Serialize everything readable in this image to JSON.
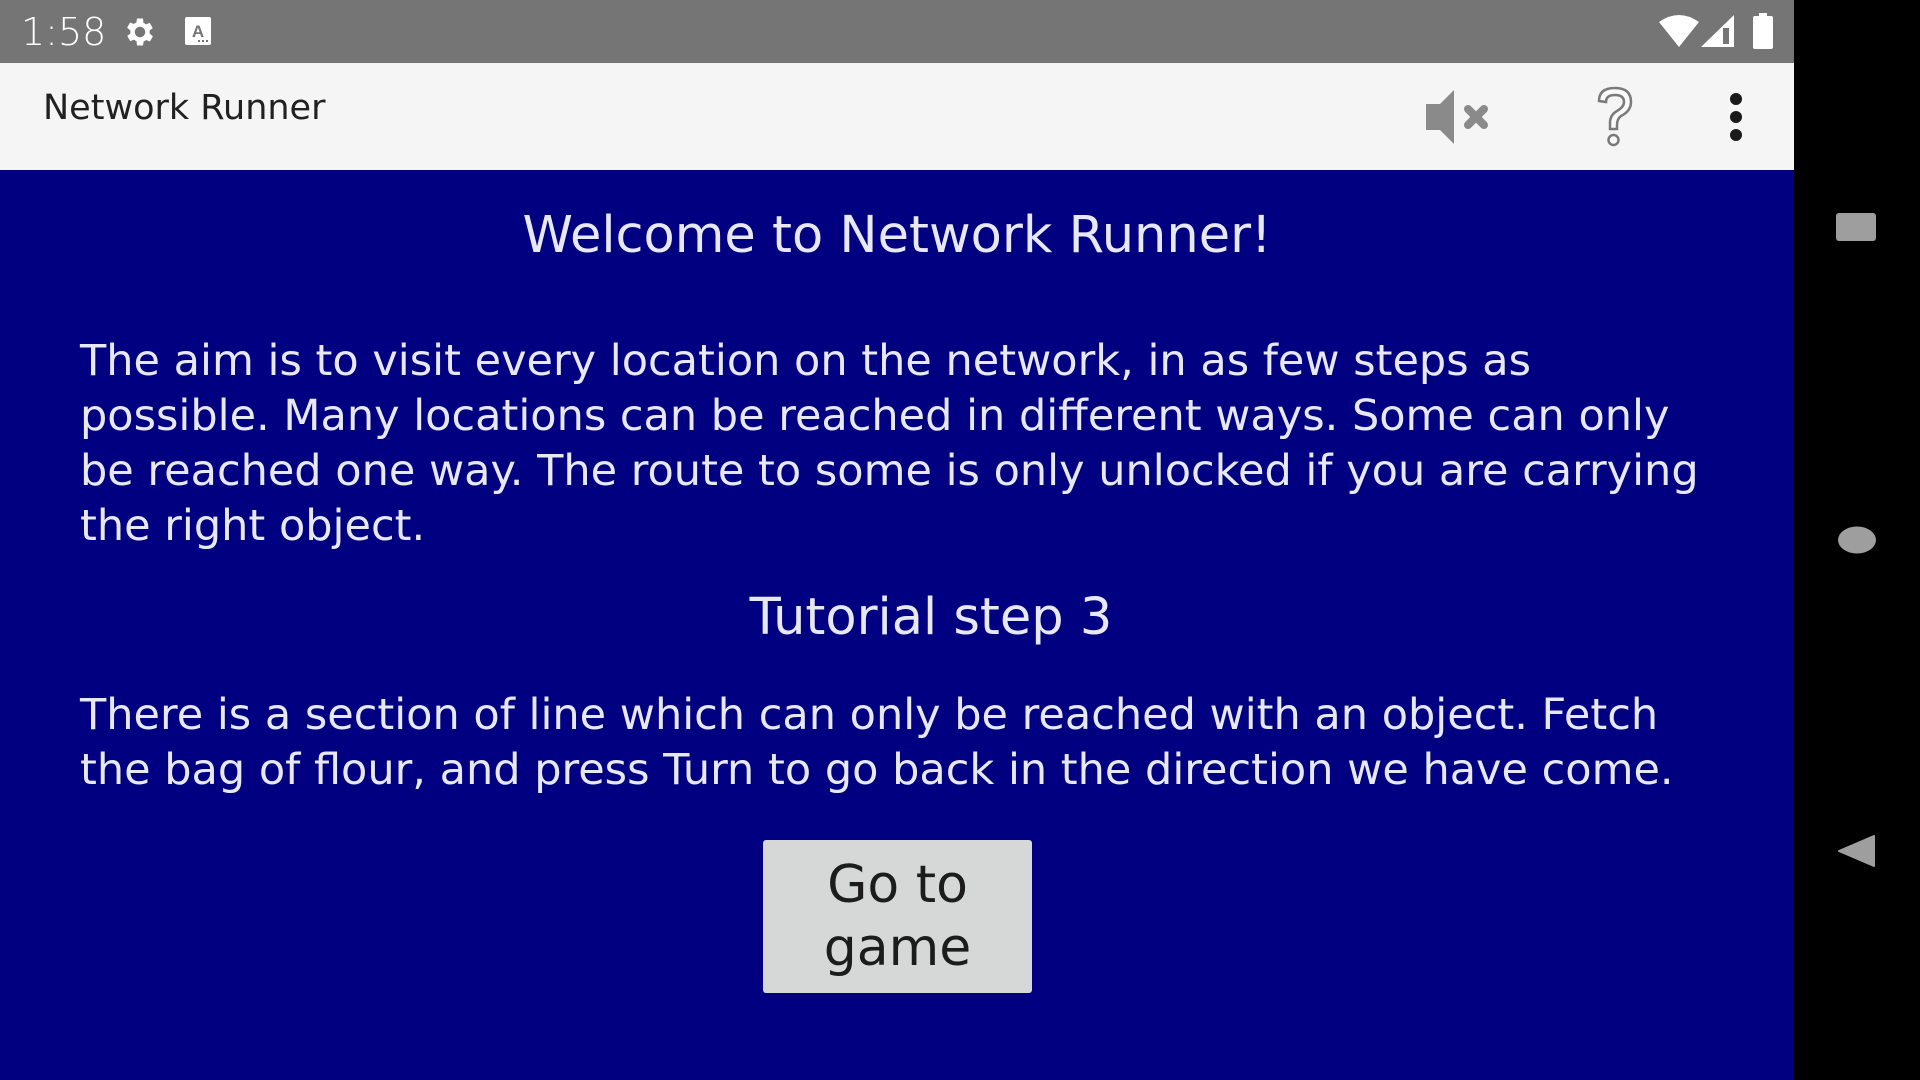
{
  "status_bar": {
    "time": "1:58",
    "icons": [
      "settings-icon",
      "keyboard-a-icon",
      "wifi-icon",
      "cellular-signal-icon",
      "battery-icon"
    ]
  },
  "app_bar": {
    "title": "Network Runner",
    "actions": [
      "mute-icon",
      "help-icon",
      "more-options-icon"
    ]
  },
  "content": {
    "welcome_heading": "Welcome to Network Runner!",
    "intro_text": "The aim is to visit every location on the network, in as few steps as possible. Many locations can be reached in different ways. Some can only be reached one way. The route to some is only unlocked if you are carrying the right object.",
    "tutorial_heading": "Tutorial step 3",
    "tutorial_text": "There is a section of line which can only be reached with an object. Fetch the bag of flour, and press Turn to go back in the direction we have come.",
    "go_button_label": "Go to game"
  },
  "colors": {
    "content_background": "#000080",
    "content_text": "#e8e8f4",
    "status_bar": "#757575",
    "app_bar": "#f5f5f5",
    "button_background": "#d6d7d7"
  },
  "nav_bar": {
    "buttons": [
      "recents-icon",
      "home-icon",
      "back-icon"
    ]
  }
}
